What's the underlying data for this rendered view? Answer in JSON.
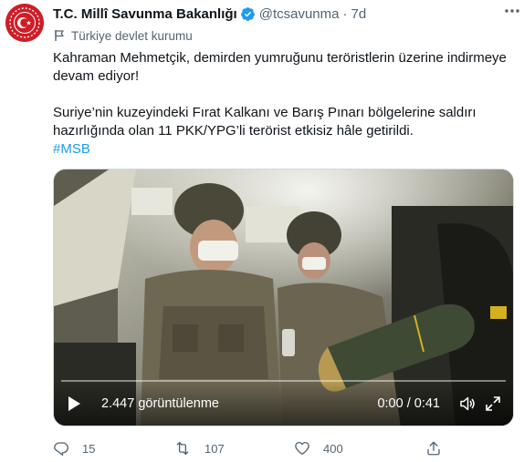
{
  "author": {
    "name": "T.C. Millî Savunma Bakanlığı",
    "handle": "@tcsavunma",
    "separator": "·",
    "time": "7d",
    "label": "Türkiye devlet kurumu"
  },
  "tweet": {
    "paragraph1": "Kahraman Mehmetçik, demirden yumruğunu teröristlerin üzerine indirmeye devam ediyor!",
    "paragraph2": "Suriye’nin kuzeyindeki Fırat Kalkanı ve Barış Pınarı bölgelerine saldırı hazırlığında olan 11 PKK/YPG’li terörist etkisiz hâle getirildi.",
    "hashtag": "#MSB"
  },
  "video": {
    "views": "2.447 görüntülenme",
    "time": "0:00 / 0:41"
  },
  "stats": {
    "replies": "15",
    "retweets": "107",
    "likes": "400"
  },
  "colors": {
    "accent": "#1d9bf0",
    "avatar_bg": "#cf1d27",
    "secondary_text": "#536471"
  },
  "icons": {
    "avatar": "msb-emblem-icon",
    "verified": "verified-badge-icon",
    "more": "more-icon",
    "label": "flag-icon",
    "reply": "reply-icon",
    "retweet": "retweet-icon",
    "like": "heart-icon",
    "share": "share-icon",
    "play": "play-icon",
    "volume": "volume-icon",
    "fullscreen": "fullscreen-icon"
  }
}
